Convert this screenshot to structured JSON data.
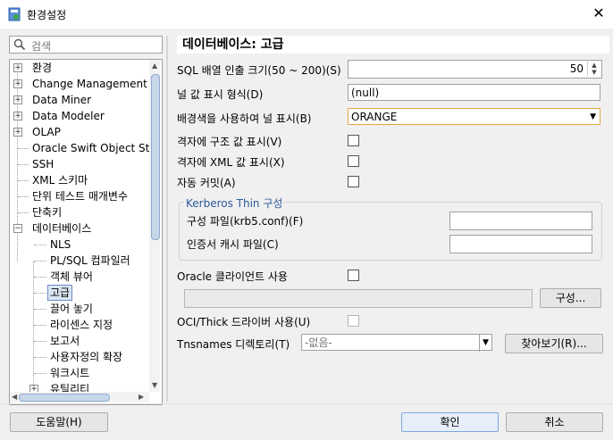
{
  "window": {
    "title": "환경설정",
    "close_glyph": "✕"
  },
  "sidebar": {
    "search_placeholder": "검색",
    "items": [
      {
        "label": "환경",
        "expand": "+"
      },
      {
        "label": "Change Management D",
        "expand": "+"
      },
      {
        "label": "Data Miner",
        "expand": "+"
      },
      {
        "label": "Data Modeler",
        "expand": "+"
      },
      {
        "label": "OLAP",
        "expand": "+"
      },
      {
        "label": "Oracle Swift Object Sto"
      },
      {
        "label": "SSH"
      },
      {
        "label": "XML 스키마"
      },
      {
        "label": "단위 테스트 매개변수"
      },
      {
        "label": "단축키"
      },
      {
        "label": "데이터베이스",
        "expand": "−"
      },
      {
        "label": "NLS"
      },
      {
        "label": "PL/SQL 컴파일러"
      },
      {
        "label": "객체 뷰어"
      },
      {
        "label": "고급"
      },
      {
        "label": "끌어 놓기"
      },
      {
        "label": "라이센스 지정"
      },
      {
        "label": "보고서"
      },
      {
        "label": "사용자정의 확장"
      },
      {
        "label": "워크시트"
      },
      {
        "label": "유틸리티",
        "expand": "+"
      }
    ]
  },
  "panel": {
    "title": "데이터베이스: 고급",
    "sql_fetch_label": "SQL 배열 인출 크기(50 ~ 200)(S)",
    "sql_fetch_value": "50",
    "null_display_label": "널 값 표시 형식(D)",
    "null_display_value": "(null)",
    "bg_color_label": "배경색을 사용하여 널 표시(B)",
    "bg_color_value": "ORANGE",
    "grid_struct_label": "격자에 구조 값 표시(V)",
    "grid_xml_label": "격자에 XML 값 표시(X)",
    "autocommit_label": "자동 커밋(A)",
    "kerberos_title": "Kerberos Thin 구성",
    "config_file_label": "구성 파일(krb5.conf)(F)",
    "cred_cache_label": "인증서 캐시 파일(C)",
    "oracle_client_label": "Oracle 클라이언트 사용",
    "configure_button": "구성...",
    "oci_label": "OCI/Thick 드라이버 사용(U)",
    "tnsnames_label": "Tnsnames 디렉토리(T)",
    "tnsnames_value": "-없음-",
    "browse_button": "찾아보기(R)..."
  },
  "footer": {
    "help": "도움말(H)",
    "ok": "확인",
    "cancel": "취소"
  },
  "colors": {
    "accent": "#2c5a99",
    "select_border": "#e0a64c"
  }
}
